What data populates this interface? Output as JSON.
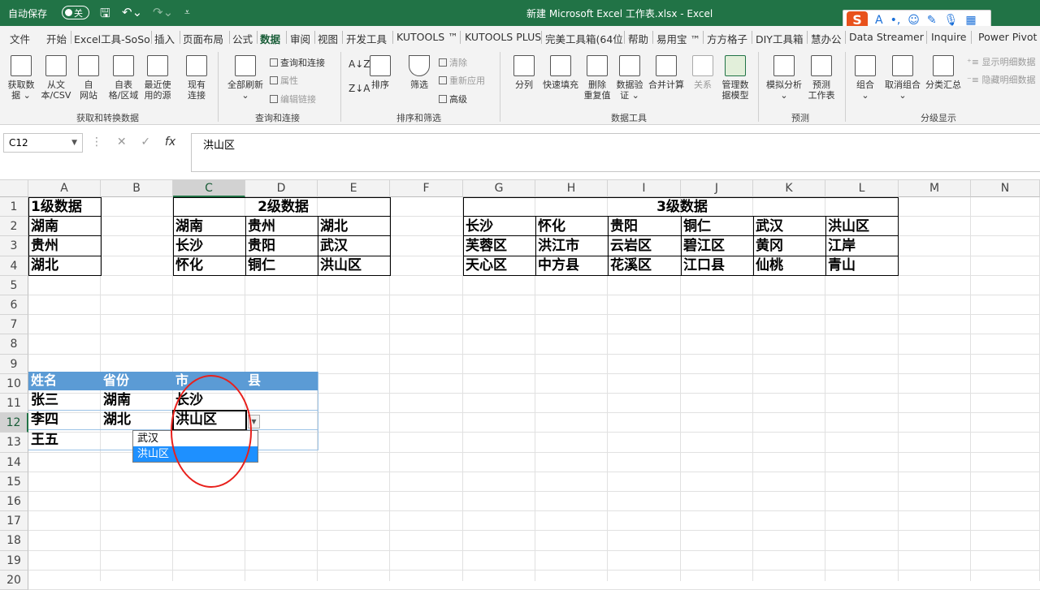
{
  "titlebar": {
    "autosave_label": "自动保存",
    "autosave_state": "关",
    "title": "新建 Microsoft Excel 工作表.xlsx  -  Excel"
  },
  "menu": {
    "tabs": [
      "文件",
      "开始",
      "Excel工具-SoSo",
      "插入",
      "页面布局",
      "公式",
      "数据",
      "审阅",
      "视图",
      "开发工具",
      "KUTOOLS ™",
      "KUTOOLS PLUS",
      "完美工具箱(64位",
      "帮助",
      "易用宝 ™",
      "方方格子",
      "DIY工具箱",
      "慧办公",
      "Data Streamer",
      "Inquire",
      "Power Pivot"
    ],
    "active_tab": "数据"
  },
  "ribbon": {
    "get_data": {
      "label1": "获取数",
      "label2": "据 ⌄"
    },
    "from_csv": {
      "label1": "从文",
      "label2": "本/CSV"
    },
    "from_web": {
      "label1": "自",
      "label2": "网站"
    },
    "from_table": {
      "label1": "自表",
      "label2": "格/区域"
    },
    "recent_sources": {
      "label1": "最近使",
      "label2": "用的源"
    },
    "existing_conn": {
      "label1": "现有",
      "label2": "连接"
    },
    "group_get": "获取和转换数据",
    "refresh_all": {
      "label1": "全部刷新",
      "label2": "⌄"
    },
    "queries_conn": "查询和连接",
    "properties": "属性",
    "edit_links": "编辑链接",
    "group_queries": "查询和连接",
    "sort": "排序",
    "filter": "筛选",
    "clear": "清除",
    "reapply": "重新应用",
    "advanced": "高级",
    "group_sort": "排序和筛选",
    "split": "分列",
    "flash_fill": "快速填充",
    "remove_dup": {
      "label1": "删除",
      "label2": "重复值"
    },
    "validation": {
      "label1": "数据验",
      "label2": "证 ⌄"
    },
    "consolidate": "合并计算",
    "relations": "关系",
    "data_model": {
      "label1": "管理数",
      "label2": "据模型"
    },
    "group_tools": "数据工具",
    "what_if": {
      "label1": "模拟分析",
      "label2": "⌄"
    },
    "forecast": {
      "label1": "预测",
      "label2": "工作表"
    },
    "group_forecast": "预测",
    "group_btn": {
      "label1": "组合",
      "label2": "⌄"
    },
    "ungroup": {
      "label1": "取消组合",
      "label2": "⌄"
    },
    "subtotal": "分类汇总",
    "show_detail": "显示明细数据",
    "hide_detail": "隐藏明细数据",
    "group_outline": "分级显示"
  },
  "formula_bar": {
    "name_box": "C12",
    "content": "洪山区"
  },
  "columns": [
    "A",
    "B",
    "C",
    "D",
    "E",
    "F",
    "G",
    "H",
    "I",
    "J",
    "K",
    "L",
    "M",
    "N"
  ],
  "rows": [
    "1",
    "2",
    "3",
    "4",
    "5",
    "6",
    "7",
    "8",
    "9",
    "10",
    "11",
    "12",
    "13",
    "14",
    "15",
    "16",
    "17",
    "18",
    "19",
    "20"
  ],
  "level1": {
    "header": "1级数据",
    "items": [
      "湖南",
      "贵州",
      "湖北"
    ]
  },
  "level2": {
    "header": "2级数据",
    "row2": [
      "湖南",
      "贵州",
      "湖北"
    ],
    "row3": [
      "长沙",
      "贵阳",
      "武汉"
    ],
    "row4": [
      "怀化",
      "铜仁",
      "洪山区"
    ]
  },
  "level3": {
    "header": "3级数据",
    "row2": [
      "长沙",
      "怀化",
      "贵阳",
      "铜仁",
      "武汉",
      "洪山区"
    ],
    "row3": [
      "芙蓉区",
      "洪江市",
      "云岩区",
      "碧江区",
      "黄冈",
      "江岸"
    ],
    "row4": [
      "天心区",
      "中方县",
      "花溪区",
      "江口县",
      "仙桃",
      "青山"
    ]
  },
  "table": {
    "headers": [
      "姓名",
      "省份",
      "市",
      "县"
    ],
    "rows": [
      [
        "张三",
        "湖南",
        "长沙",
        ""
      ],
      [
        "李四",
        "湖北",
        "洪山区",
        ""
      ],
      [
        "王五",
        "",
        "",
        ""
      ]
    ]
  },
  "dropdown": {
    "options": [
      "武汉",
      "洪山区"
    ],
    "highlighted": "洪山区"
  },
  "colors": {
    "excel_green": "#217346",
    "table_header": "#5b9bd5",
    "annotation_circle": "#e8201c",
    "dropdown_highlight": "#1e90ff"
  }
}
